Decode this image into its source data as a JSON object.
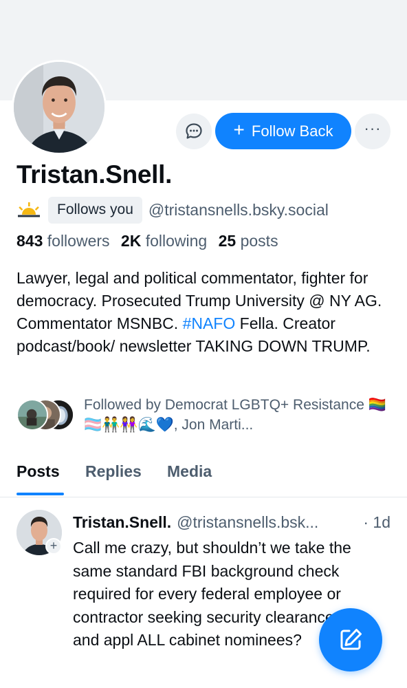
{
  "profile": {
    "name": "Tristan.Snell.",
    "follows_you": "Follows you",
    "handle": "@tristansnells.bsky.social",
    "stats": {
      "followers_count": "843",
      "followers_label": "followers",
      "following_count": "2K",
      "following_label": "following",
      "posts_count": "25",
      "posts_label": "posts"
    },
    "bio": {
      "part1": "Lawyer, legal and political commentator, fighter for democracy. Prosecuted Trump University @ NY AG. Commentator MSNBC. ",
      "hashtag": "#NAFO",
      "part2": " Fella. Creator podcast/book/ newsletter TAKING DOWN TRUMP."
    },
    "followed_by": "Followed by Democrat LGBTQ+ Resistance 🏳️‍🌈🏳️‍⚧️👬👭🌊💙, Jon Marti..."
  },
  "actions": {
    "message_icon": "message-bubble-icon",
    "follow_label": "Follow Back",
    "follow_icon": "plus-icon",
    "more_label": "···"
  },
  "tabs": [
    {
      "label": "Posts",
      "active": true
    },
    {
      "label": "Replies",
      "active": false
    },
    {
      "label": "Media",
      "active": false
    }
  ],
  "post": {
    "author": "Tristan.Snell.",
    "handle": "@tristansnells.bsk...",
    "time": "· 1d",
    "text": "Call me crazy, but shouldn’t we take the same standard FBI background check required for every federal employee or contractor seeking security clearance — and appl ALL cabinet nominees?",
    "avatar_badge": "+"
  },
  "colors": {
    "accent": "#1083fe",
    "banner": "#f1f3f5",
    "muted_text": "#4d5d6e"
  },
  "icons": {
    "sun": "sun-horizon-icon",
    "compose": "compose-pencil-icon"
  }
}
